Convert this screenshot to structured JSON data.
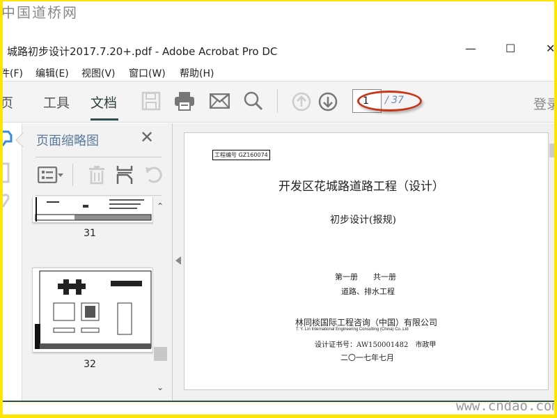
{
  "watermark_top": "中国道桥网",
  "watermark_bottom": "www.cndao.com",
  "window": {
    "title": "城路初步设计2017.7.20+.pdf - Adobe Acrobat Pro DC",
    "minimize": "—",
    "maximize": "☐",
    "close": "✕"
  },
  "menu": [
    {
      "label": "件(F)"
    },
    {
      "label": "编辑(E)"
    },
    {
      "label": "视图(V)"
    },
    {
      "label": "窗口(W)"
    },
    {
      "label": "帮助(H)"
    }
  ],
  "tabs": [
    {
      "label": "主页"
    },
    {
      "label": "工具"
    },
    {
      "label": "文档",
      "active": true
    }
  ],
  "toolbar": {
    "icons": [
      "save-icon",
      "print-icon",
      "mail-icon",
      "search-icon",
      "page-up-icon",
      "page-down-icon"
    ],
    "current_page": "1",
    "total_pages": "/ 37",
    "login": "登录"
  },
  "annotation_color": "#c8361a",
  "panel": {
    "title": "页面缩略图",
    "close": "✕",
    "thumbnails": [
      {
        "page": "31"
      },
      {
        "page": "32"
      }
    ]
  },
  "document": {
    "project_no": "工程编号 GZ160074",
    "title": "开发区花城路道路工程（设计）",
    "subtitle": "初步设计(报规)",
    "volume": "第一册　　共一册",
    "section": "道路、排水工程",
    "company_cn": "林同棪国际工程咨询（中国）有限公司",
    "company_en": "T. Y. Lin International Engineering Consulting (China) Co.,Ltd",
    "certificate": "设计证书号：AW150001482　市政甲",
    "date": "二〇一七年七月"
  }
}
